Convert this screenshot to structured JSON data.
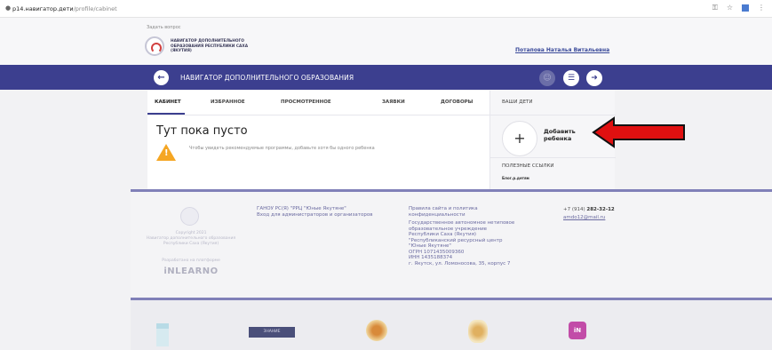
{
  "browser": {
    "url_host": "p14.навигатор.дети",
    "url_path": "/profile/cabinet"
  },
  "topbar": {
    "ask_link": "Задать вопрос",
    "org_name": "НАВИГАТОР ДОПОЛНИТЕЛЬНОГО ОБРАЗОВАНИЯ РЕСПУБЛИКИ САХА (ЯКУТИЯ)",
    "user_name": "Потапова Наталья Витальевна"
  },
  "navbar": {
    "title": "НАВИГАТОР ДОПОЛНИТЕЛЬНОГО ОБРАЗОВАНИЯ",
    "back_icon": "arrow-left-icon",
    "icons": [
      "user-icon",
      "filter-icon",
      "logout-icon"
    ],
    "color": "#3c3f8f"
  },
  "tabs": [
    {
      "label": "КАБИНЕТ",
      "active": true
    },
    {
      "label": "ИЗБРАННОЕ",
      "active": false
    },
    {
      "label": "ПРОСМОТРЕННОЕ",
      "active": false
    },
    {
      "label": "ЗАЯВКИ",
      "active": false
    },
    {
      "label": "ДОГОВОРЫ",
      "active": false
    }
  ],
  "main": {
    "empty_title": "Тут пока пусто",
    "hint": "Чтобы увидеть рекомендуемые программы, добавьте хотя бы одного ребенка"
  },
  "side": {
    "children_title": "ВАШИ ДЕТИ",
    "add_button_symbol": "+",
    "add_label_line1": "Добавить",
    "add_label_line2": "ребенка",
    "useful_title": "ПОЛЕЗНЫЕ ССЫЛКИ",
    "useful_link": "Блог.р.детям"
  },
  "footer": {
    "copyright": "Copyright 2021",
    "org_copy": "Навигатор дополнительного образования Республики Саха (Якутия)",
    "made_by": "Разработано на платформе",
    "platform": "iNLEARNO",
    "col2_line1": "ГАНОУ РС(Я) \"РРЦ \"Юные Якутяне\"",
    "col2_line2": "Вход для администраторов и организаторов",
    "col3_policy": "Правила сайта и политика конфиденциальности",
    "col3_org": "Государственное автономное нетиповое образовательное учреждение Республики Саха (Якутия) \"Республиканский ресурсный центр \"Юные Якутяне\"",
    "col3_ogrn": "ОГРН 1071435009360",
    "col3_inn": "ИНН 1435188374",
    "col3_address": "г. Якутск, ул. Ломоносова, 35, корпус 7",
    "phone_prefix": "+7 (914)",
    "phone_number": "282-32-12",
    "email": "amdo12@mail.ru"
  },
  "partners": {
    "p2_label": "ЗНАНИЕ"
  }
}
